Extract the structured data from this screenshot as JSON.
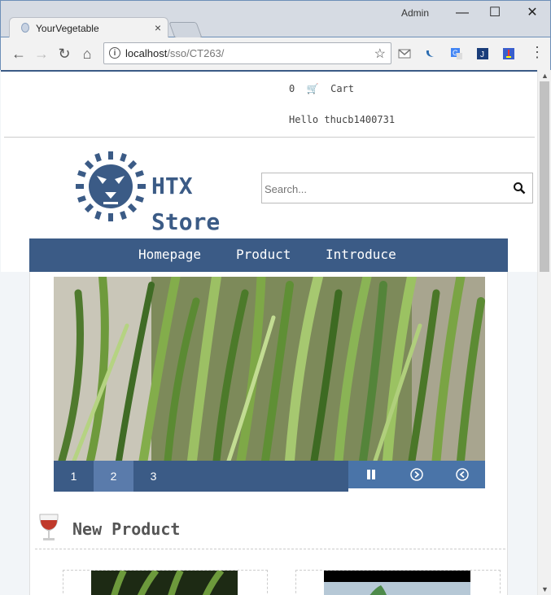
{
  "browser": {
    "tab_title": "YourVegetable",
    "tab_close": "×",
    "window_user": "Admin",
    "url_host": "localhost",
    "url_path": "/sso/CT263/",
    "window_buttons": [
      "—",
      "☐",
      "✕"
    ]
  },
  "header": {
    "cart_count": "0",
    "cart_label": "Cart",
    "greeting": "Hello thucb1400731"
  },
  "brand": {
    "line1": "HTX",
    "line2": "Store"
  },
  "search": {
    "placeholder": "Search..."
  },
  "nav": {
    "items": [
      "Homepage",
      "Product",
      "Introduce"
    ]
  },
  "slider": {
    "pages": [
      "1",
      "2",
      "3"
    ],
    "active_page": "2"
  },
  "section": {
    "title": "New Product"
  },
  "colors": {
    "brand_blue": "#3b5b86",
    "slider_active": "#5a7bab",
    "control_blue": "#4a74a8"
  }
}
